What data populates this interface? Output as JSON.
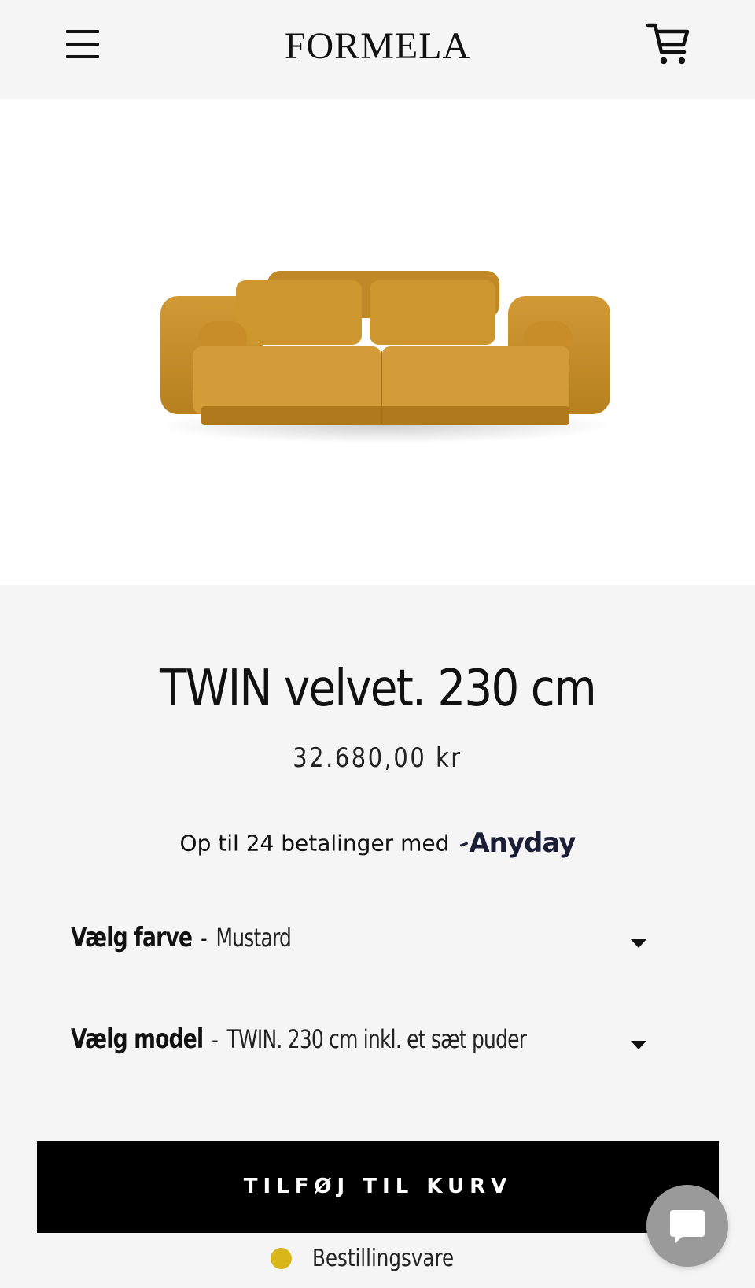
{
  "header": {
    "logo": "FORMELA",
    "menu_icon": "hamburger-menu-icon",
    "cart_icon": "shopping-cart-icon"
  },
  "product": {
    "image_alt": "Mustard velvet sofa",
    "title": "TWIN velvet. 230 cm",
    "price": "32.680,00 kr",
    "installments_text": "Op til 24 betalinger med",
    "installments_brand": "Anyday"
  },
  "options": {
    "color": {
      "label": "Vælg farve",
      "separator": "-",
      "value": "Mustard"
    },
    "model": {
      "label": "Vælg model",
      "separator": "-",
      "value": "TWIN. 230 cm inkl. et sæt puder"
    }
  },
  "cta": {
    "add_to_cart": "TILFØJ TIL KURV"
  },
  "stock": {
    "status": "Bestillingsvare",
    "dot_color": "#d9b619"
  },
  "chat": {
    "icon": "chat-bubble-icon"
  },
  "colors": {
    "background": "#f5f5f5",
    "button": "#000000",
    "accent_sofa": "#c8902e"
  }
}
